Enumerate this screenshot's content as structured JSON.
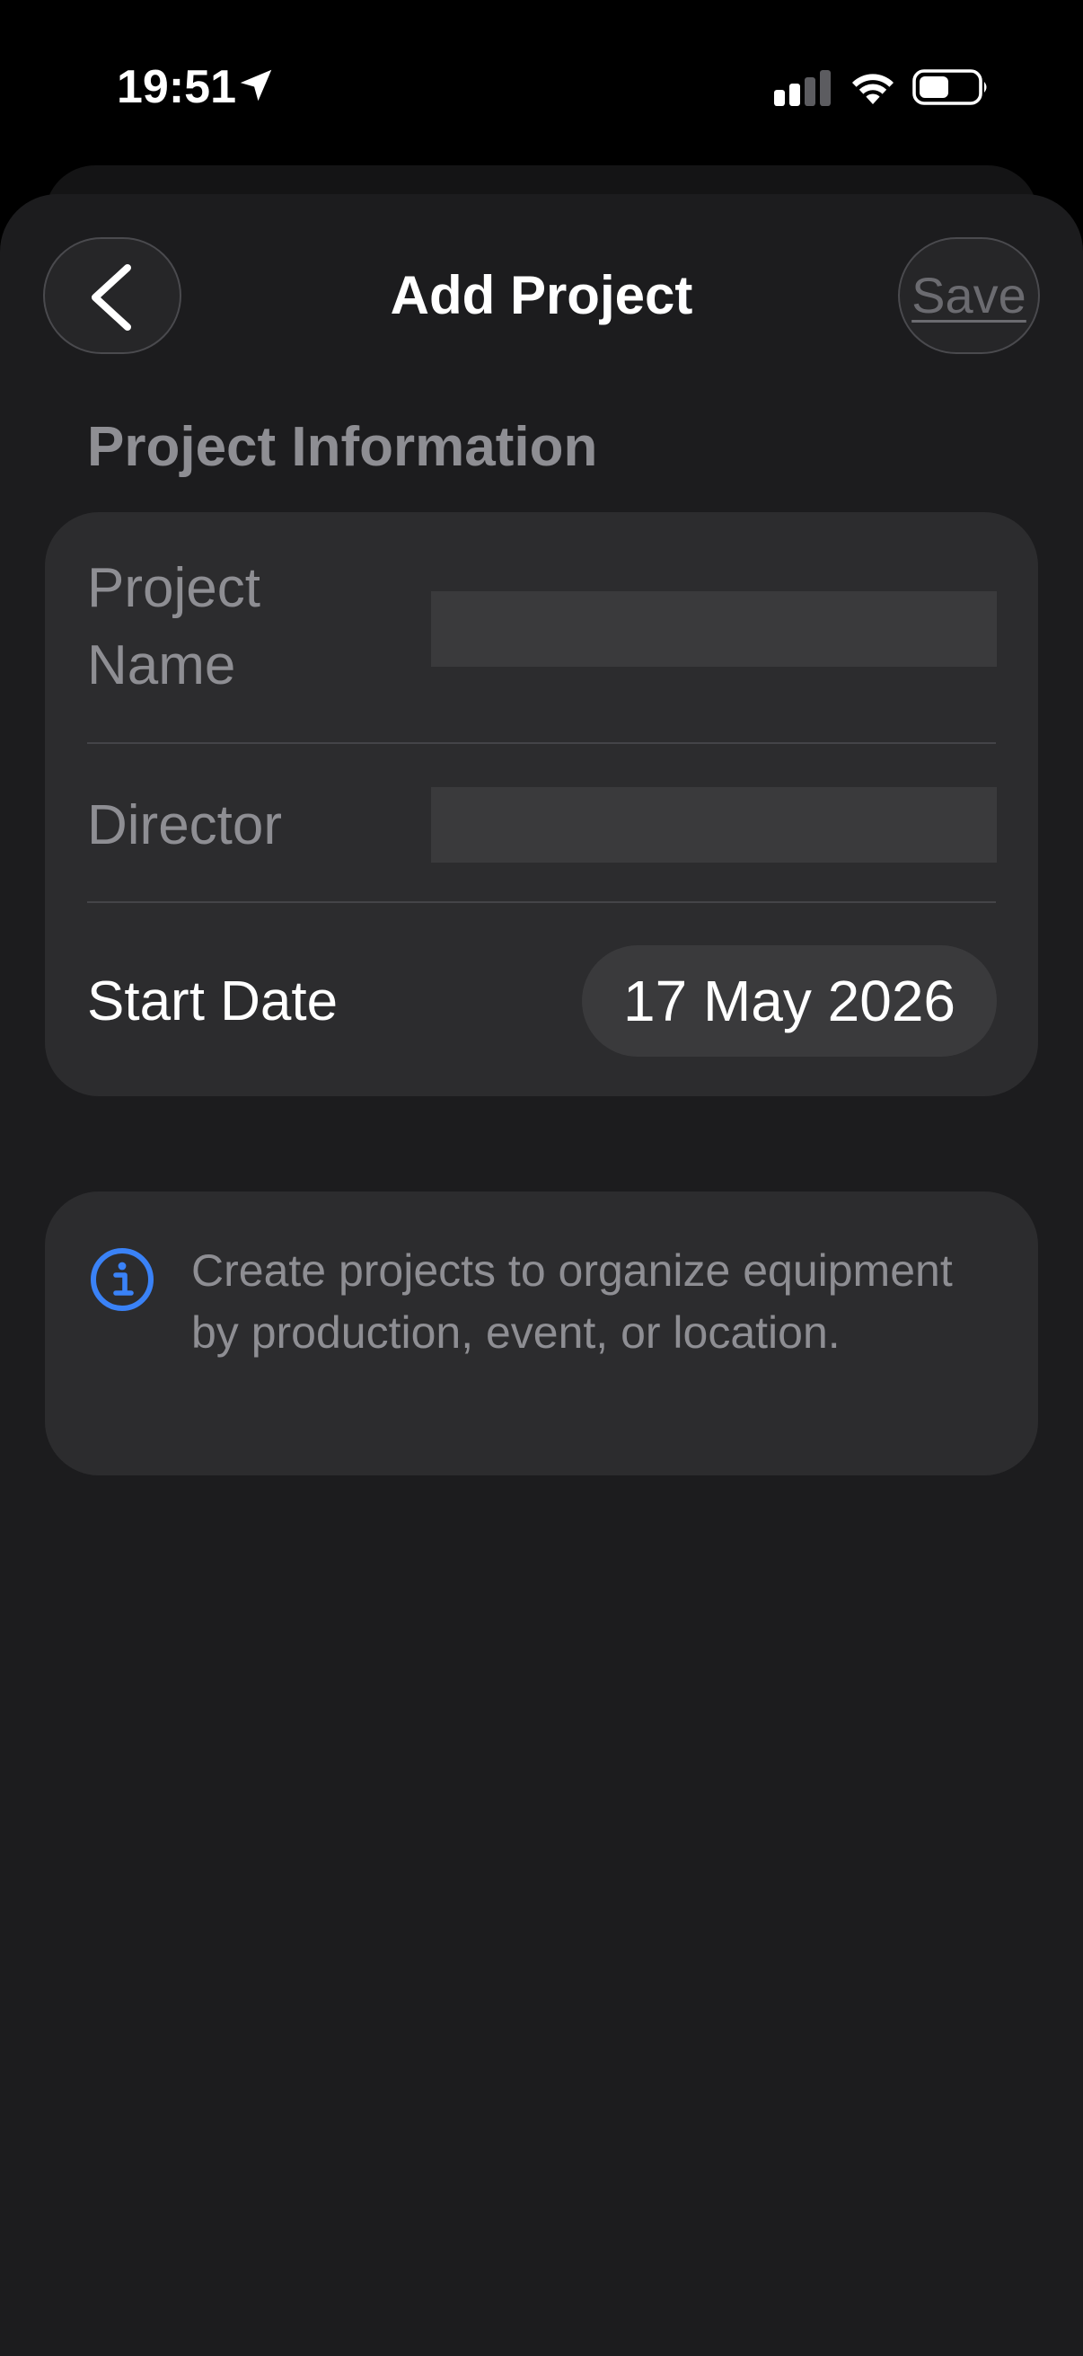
{
  "status_bar": {
    "time": "19:51",
    "icons": [
      "location-arrow-icon",
      "cellular-signal-icon",
      "wifi-icon",
      "battery-icon"
    ]
  },
  "nav": {
    "back_icon": "chevron-left-icon",
    "title": "Add Project",
    "save_label": "Save"
  },
  "section": {
    "header": "Project Information"
  },
  "form": {
    "project_name": {
      "label_line1": "Project",
      "label_line2": "Name",
      "value": ""
    },
    "director": {
      "label": "Director",
      "value": ""
    },
    "start_date": {
      "label": "Start Date",
      "value": "17 May 2026"
    }
  },
  "info": {
    "icon": "info-circle-icon",
    "text": "Create projects to organize equipment by production, event, or location."
  },
  "colors": {
    "background": "#000000",
    "sheet": "#1c1c1e",
    "card": "#2c2c2e",
    "input": "#3a3a3c",
    "secondary_text": "#8e8e93",
    "accent_blue": "#3a82f7",
    "disabled_save": "#6b6b70"
  }
}
